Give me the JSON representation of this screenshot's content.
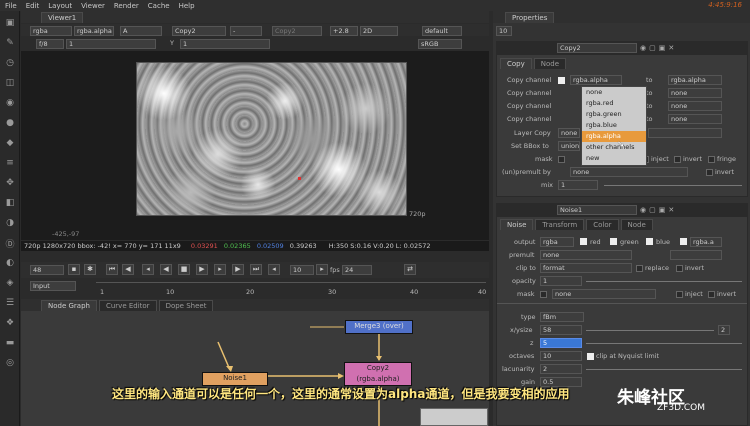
{
  "menubar": {
    "items": [
      "File",
      "Edit",
      "Layout",
      "Viewer",
      "Render",
      "Cache",
      "Help"
    ],
    "clock": "4:45:9:16"
  },
  "viewer": {
    "tab": "Viewer1",
    "channels": "rgba",
    "layer": "rgba.alpha",
    "display": "A",
    "input_a": "Copy2",
    "op": "-",
    "input_b": "Copy2",
    "gain": "+2.8",
    "view": "2D",
    "lut": "default",
    "fstop": "f/8",
    "frame_val": "1",
    "y_label": "Y",
    "y_val": "1",
    "colorspace": "sRGB",
    "corner_bl": "-425,-97",
    "corner_tr": "720p",
    "info": {
      "fmt": "720p 1280x720  bbox: -42! x= 770 y= 171   11x9",
      "r": "0.03291",
      "g": "0.02365",
      "b": "0.02509",
      "a": "0.39263",
      "hsv": "H:350 S:0.16 V:0.20  L: 0.02572"
    }
  },
  "timeline": {
    "frame": "48",
    "input": "Input",
    "step": "10",
    "fps_label": "fps",
    "fps": "24",
    "ticks": [
      "1",
      "10",
      "20",
      "30",
      "40"
    ],
    "end_label": "40"
  },
  "nodegraph": {
    "tabs": [
      "Node Graph",
      "Curve Editor",
      "Dope Sheet"
    ],
    "nodes": {
      "merge": "Merge3 (over)",
      "copy": "Copy2",
      "copy_sub": "(rgba.alpha)",
      "noise": "Noise1"
    }
  },
  "properties": {
    "title": "Properties",
    "count": "10",
    "copy": {
      "name": "Copy2",
      "tabs": [
        "Copy",
        "Node"
      ],
      "rows": [
        {
          "label": "Copy channel",
          "src": "rgba.alpha",
          "to": "to",
          "dst": "rgba.alpha"
        },
        {
          "label": "Copy channel",
          "src": "",
          "to": "to",
          "dst": "none"
        },
        {
          "label": "Copy channel",
          "src": "",
          "to": "to",
          "dst": "none"
        },
        {
          "label": "Copy channel",
          "src": "",
          "to": "to",
          "dst": "none"
        }
      ],
      "layer_copy": "Layer Copy",
      "layer_copy_val": "none",
      "set_bbox": "Set BBox to",
      "set_bbox_val": "union",
      "mask": "mask",
      "inject": "inject",
      "invert": "invert",
      "fringe": "fringe",
      "unpremult": "(un)premult by",
      "unpremult_val": "none",
      "mix": "mix",
      "mix_val": "1",
      "menu": [
        "none",
        "rgba.red",
        "rgba.green",
        "rgba.blue",
        "rgba.alpha",
        "other channels",
        "new"
      ]
    },
    "noise": {
      "name": "Noise1",
      "tabs": [
        "Noise",
        "Transform",
        "Color",
        "Node"
      ],
      "output": "output",
      "output_val": "rgba",
      "red": "red",
      "green": "green",
      "blue": "blue",
      "alpha": "rgba.a",
      "premult": "premult",
      "premult_val": "none",
      "clip": "clip to",
      "clip_val": "format",
      "replace": "replace",
      "invert": "invert",
      "opacity": "opacity",
      "opacity_val": "1",
      "mask": "mask",
      "mask_val": "none",
      "inject": "inject",
      "type": "type",
      "type_val": "fBm",
      "xysize": "x/ysize",
      "xysize_val": "58",
      "xysize_end": "2",
      "z": "z",
      "z_val": "5",
      "octaves": "octaves",
      "octaves_val": "10",
      "clip_nyq": "clip at Nyquist limit",
      "lacunarity": "lacunarity",
      "lacunarity_val": "2",
      "gain": "gain",
      "gain_val": "0.5"
    }
  },
  "subtitle": "这里的输入通道可以是任何一个，这里的通常设置为alpha通道，但是我要变相的应用",
  "watermark": {
    "name": "朱峰社区",
    "site": "ZF3D.COM"
  }
}
